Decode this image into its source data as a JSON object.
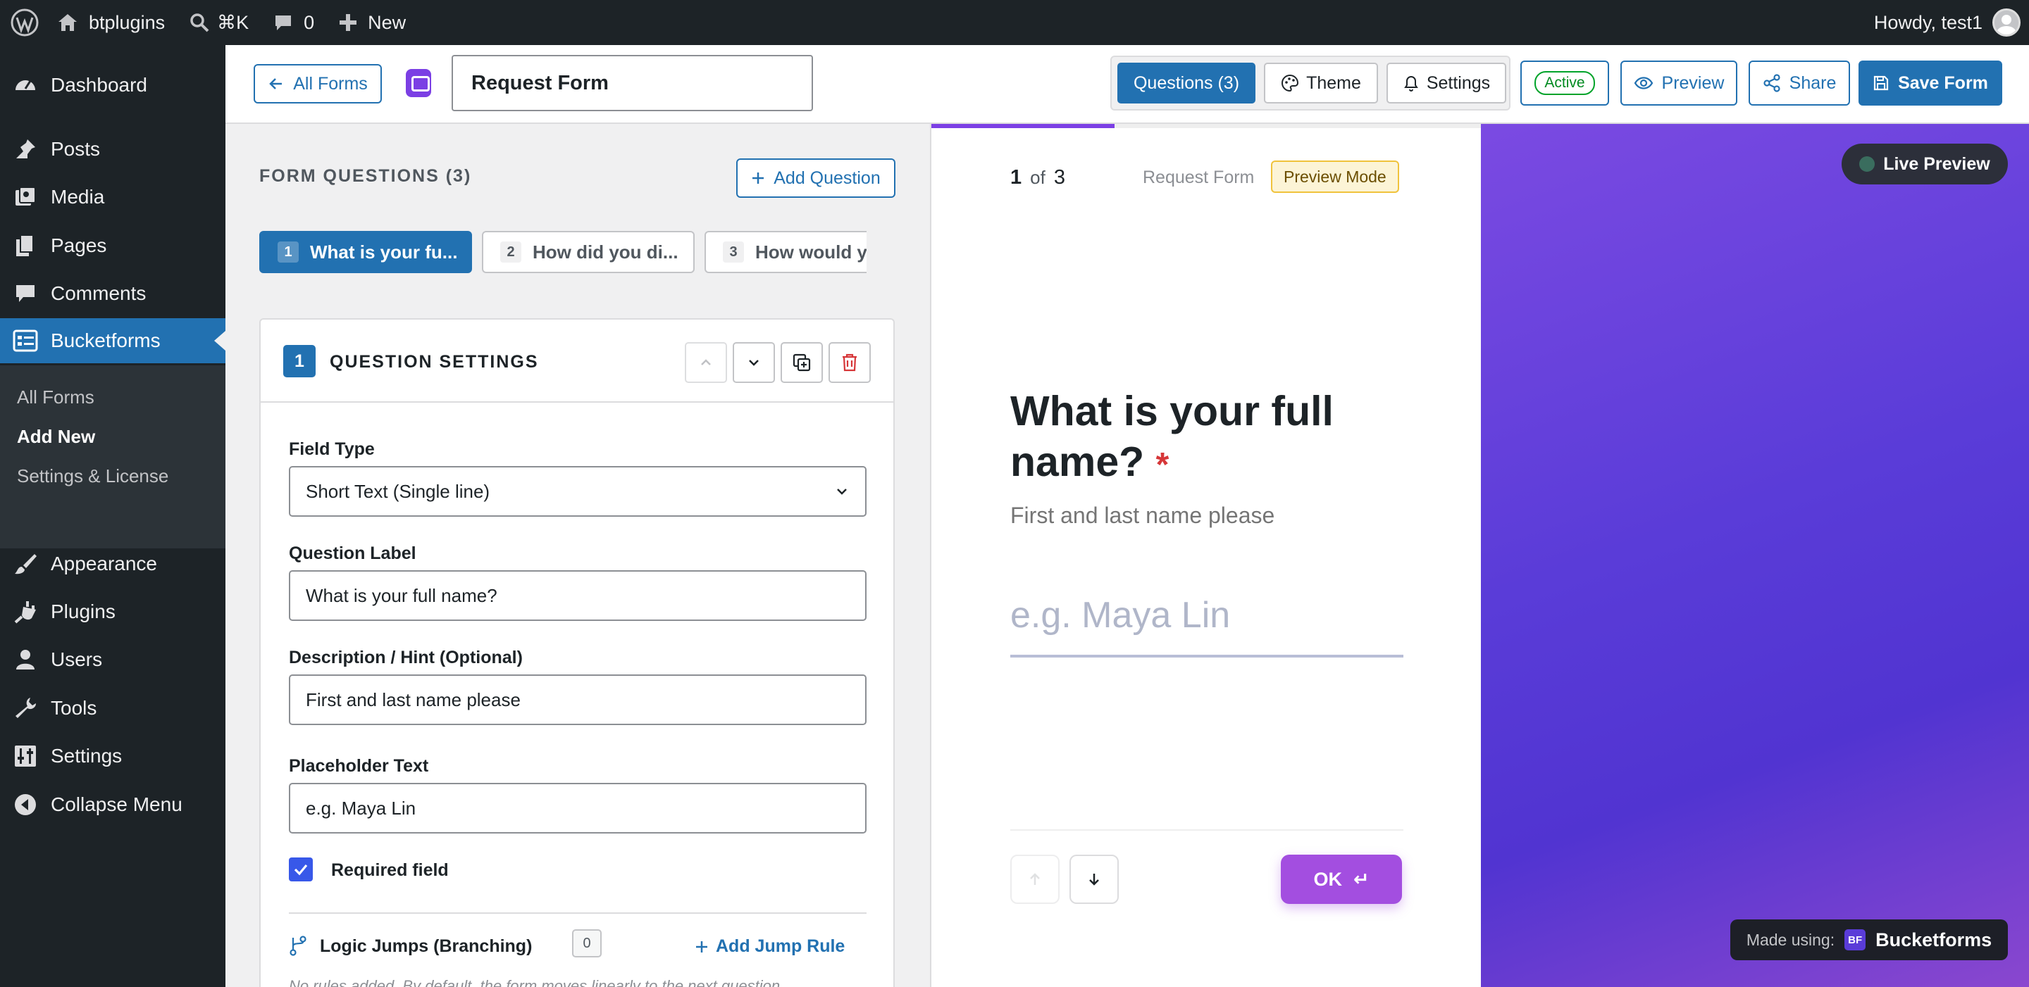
{
  "adminbar": {
    "site_name": "btplugins",
    "search_shortcut": "⌘K",
    "comments_count": "0",
    "new_label": "New",
    "greeting": "Howdy, test1"
  },
  "sidebar": {
    "items": [
      {
        "label": "Dashboard",
        "icon": "dashboard-icon"
      },
      {
        "label": "Posts",
        "icon": "pin-icon"
      },
      {
        "label": "Media",
        "icon": "media-icon"
      },
      {
        "label": "Pages",
        "icon": "pages-icon"
      },
      {
        "label": "Comments",
        "icon": "comment-icon"
      },
      {
        "label": "Bucketforms",
        "icon": "form-icon"
      },
      {
        "label": "Appearance",
        "icon": "brush-icon"
      },
      {
        "label": "Plugins",
        "icon": "plugin-icon"
      },
      {
        "label": "Users",
        "icon": "user-icon"
      },
      {
        "label": "Tools",
        "icon": "wrench-icon"
      },
      {
        "label": "Settings",
        "icon": "sliders-icon"
      },
      {
        "label": "Collapse Menu",
        "icon": "collapse-icon"
      }
    ],
    "submenu": [
      "All Forms",
      "Add New",
      "Settings & License"
    ]
  },
  "toolbar": {
    "all_forms": "All Forms",
    "form_title": "Request Form",
    "tabs": [
      "Questions (3)",
      "Theme",
      "Settings"
    ],
    "status": "Active",
    "preview": "Preview",
    "share": "Share",
    "save": "Save Form"
  },
  "editor": {
    "heading": "FORM QUESTIONS (3)",
    "add_question": "Add Question",
    "question_tabs": [
      {
        "num": "1",
        "label": "What is your fu..."
      },
      {
        "num": "2",
        "label": "How did you di..."
      },
      {
        "num": "3",
        "label": "How would yo..."
      }
    ],
    "settings": {
      "num": "1",
      "title": "QUESTION SETTINGS",
      "field_type_label": "Field Type",
      "field_type_value": "Short Text (Single line)",
      "question_label_label": "Question Label",
      "question_label_value": "What is your full name?",
      "description_label": "Description / Hint (Optional)",
      "description_value": "First and last name please",
      "placeholder_label": "Placeholder Text",
      "placeholder_value": "e.g. Maya Lin",
      "required_label": "Required field",
      "logic_label": "Logic Jumps (Branching)",
      "logic_count": "0",
      "add_jump": "Add Jump Rule",
      "note": "No rules added. By default, the form moves linearly to the next question."
    }
  },
  "preview": {
    "current": "1",
    "of": "of",
    "total": "3",
    "form_name": "Request Form",
    "mode": "Preview Mode",
    "progress": 0.333,
    "question": "What is your full name?",
    "required_mark": "*",
    "hint": "First and last name please",
    "placeholder": "e.g. Maya Lin",
    "ok": "OK",
    "ok_icon": "↵",
    "live_preview": "Live Preview",
    "made_using": "Made using:",
    "brand_badge": "BF",
    "brand": "Bucketforms"
  },
  "colors": {
    "wp_dark": "#1d2327",
    "wp_blue": "#2271b1",
    "accent_purple": "#a34ee0",
    "gradient_purple": "#5a3cd8"
  }
}
